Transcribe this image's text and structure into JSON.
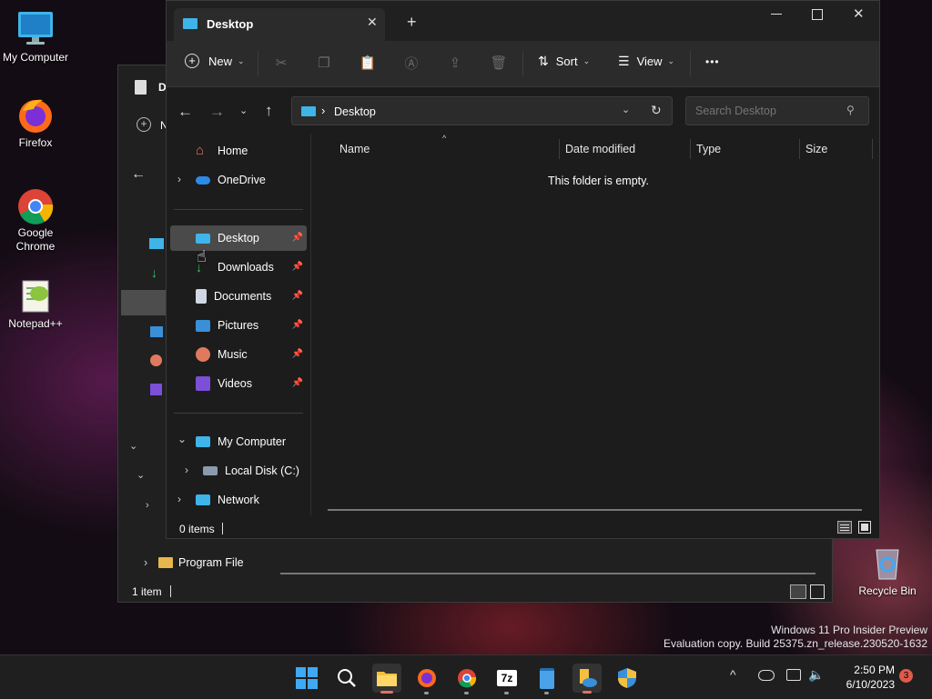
{
  "desktop": {
    "icons": [
      {
        "label": "My Computer"
      },
      {
        "label": "Firefox"
      },
      {
        "label": "Google Chrome"
      },
      {
        "label": "Notepad++"
      },
      {
        "label": "Recycle Bin"
      }
    ],
    "watermark_line1": "Windows 11 Pro Insider Preview",
    "watermark_line2": "Evaluation copy. Build 25375.zn_release.230520-1632"
  },
  "back_window": {
    "title_fragment": "D",
    "new_fragment": "N",
    "tree_item": "Program File",
    "status": "1 item"
  },
  "window": {
    "tab_title": "Desktop",
    "toolbar": {
      "new_label": "New",
      "sort_label": "Sort",
      "view_label": "View",
      "more_label": "•••"
    },
    "address": {
      "path": "Desktop",
      "separator": "›"
    },
    "search": {
      "placeholder": "Search Desktop"
    },
    "nav": {
      "home": "Home",
      "onedrive": "OneDrive",
      "quick": [
        "Desktop",
        "Downloads",
        "Documents",
        "Pictures",
        "Music",
        "Videos"
      ],
      "my_computer": "My Computer",
      "local_disk": "Local Disk (C:)",
      "network": "Network"
    },
    "columns": [
      "Name",
      "Date modified",
      "Type",
      "Size"
    ],
    "empty_message": "This folder is empty.",
    "status": "0 items"
  },
  "taskbar": {
    "time": "2:50 PM",
    "date": "6/10/2023",
    "notification_count": "3",
    "sevenzip_label": "7z"
  }
}
